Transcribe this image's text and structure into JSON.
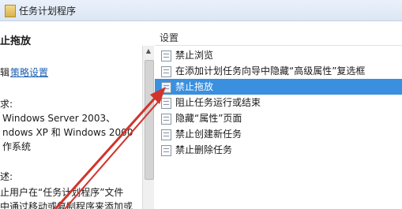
{
  "window": {
    "title": "任务计划程序"
  },
  "left_pane": {
    "heading": "止拖放",
    "edit_prefix": "辑",
    "edit_link": "策略设置",
    "requirements_label": "求:",
    "req_line1": "Windows Server 2003、",
    "req_line2": "ndows XP 和 Windows 2000",
    "req_line3": "作系统",
    "description_label": "述:",
    "desc_line1": "止用户在“任务计划程序”文件",
    "desc_line2": "中通过移动或复制程序来添加或"
  },
  "right_pane": {
    "column_header": "设置",
    "items": [
      {
        "label": "禁止浏览"
      },
      {
        "label": "在添加计划任务向导中隐藏“高级属性”复选框"
      },
      {
        "label": "禁止拖放"
      },
      {
        "label": "阻止任务运行或结束"
      },
      {
        "label": "隐藏“属性”页面"
      },
      {
        "label": "禁止创建新任务"
      },
      {
        "label": "禁止删除任务"
      }
    ],
    "selected_index": 2
  },
  "annotation": {
    "arrow_color": "#d0342c"
  }
}
